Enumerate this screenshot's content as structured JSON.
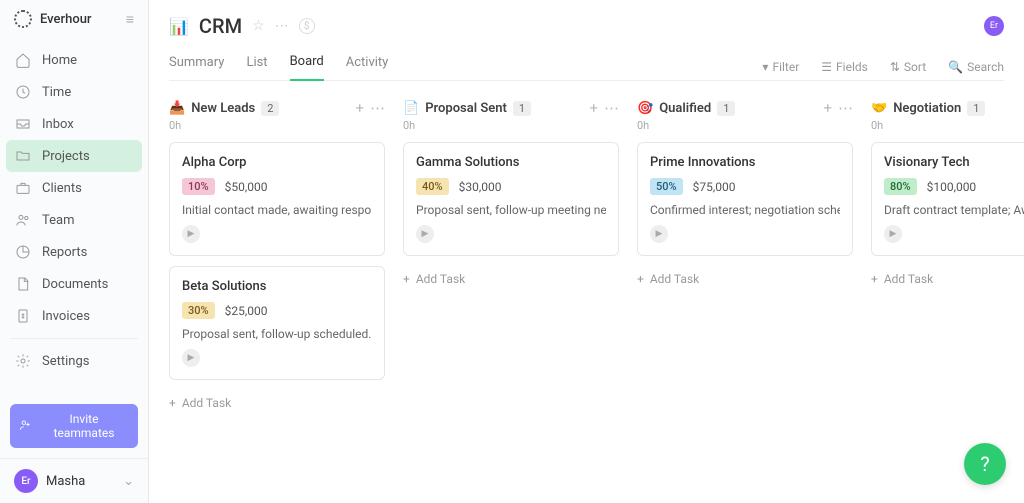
{
  "brand": "Everhour",
  "sidebar": {
    "items": [
      {
        "label": "Home"
      },
      {
        "label": "Time"
      },
      {
        "label": "Inbox"
      },
      {
        "label": "Projects"
      },
      {
        "label": "Clients"
      },
      {
        "label": "Team"
      },
      {
        "label": "Reports"
      },
      {
        "label": "Documents"
      },
      {
        "label": "Invoices"
      }
    ],
    "settings": "Settings",
    "invite": "Invite teammates",
    "user": {
      "initials": "Er",
      "name": "Masha"
    }
  },
  "header": {
    "title": "CRM",
    "avatar": "Er",
    "tabs": [
      "Summary",
      "List",
      "Board",
      "Activity"
    ],
    "actions": {
      "filter": "Filter",
      "fields": "Fields",
      "sort": "Sort",
      "search": "Search"
    }
  },
  "columns": [
    {
      "emoji": "📥",
      "title": "New Leads",
      "count": "2",
      "sub": "0h",
      "cards": [
        {
          "title": "Alpha Corp",
          "pct": "10%",
          "pcls": "p10",
          "amount": "$50,000",
          "desc": "Initial contact made, awaiting response."
        },
        {
          "title": "Beta Solutions",
          "pct": "30%",
          "pcls": "p30",
          "amount": "$25,000",
          "desc": "Proposal sent, follow-up scheduled."
        }
      ]
    },
    {
      "emoji": "📄",
      "title": "Proposal Sent",
      "count": "1",
      "sub": "0h",
      "cards": [
        {
          "title": "Gamma Solutions",
          "pct": "40%",
          "pcls": "p40",
          "amount": "$30,000",
          "desc": "Proposal sent, follow-up meeting next week."
        }
      ]
    },
    {
      "emoji": "🎯",
      "title": "Qualified",
      "count": "1",
      "sub": "0h",
      "cards": [
        {
          "title": "Prime Innovations",
          "pct": "50%",
          "pcls": "p50",
          "amount": "$75,000",
          "desc": "Confirmed interest; negotiation scheduled."
        }
      ]
    },
    {
      "emoji": "🤝",
      "title": "Negotiation",
      "count": "1",
      "sub": "0h",
      "cards": [
        {
          "title": "Visionary Tech",
          "pct": "80%",
          "pcls": "p80",
          "amount": "$100,000",
          "desc": "Draft contract template; Awaiting"
        }
      ]
    }
  ],
  "add_task": "Add Task"
}
